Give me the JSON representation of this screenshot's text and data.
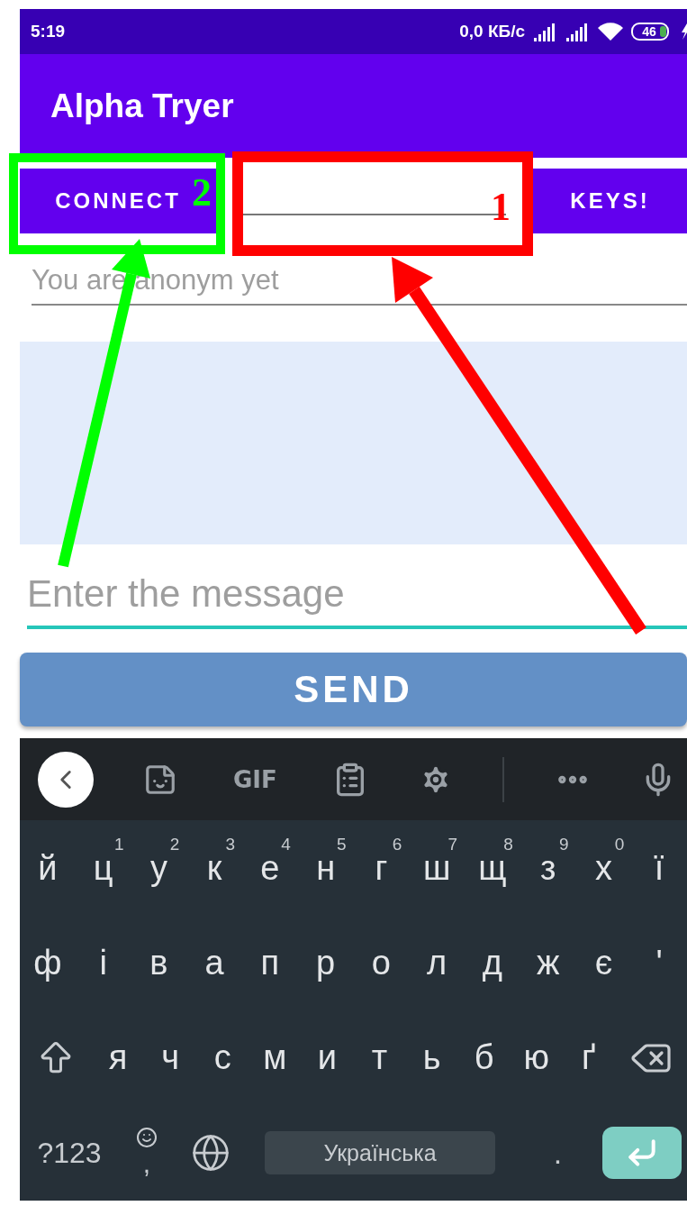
{
  "status_bar": {
    "time": "5:19",
    "network_speed": "0,0 КБ/с",
    "battery": "46"
  },
  "app_bar": {
    "title": "Alpha Tryer"
  },
  "action_row": {
    "connect_button": "CONNECT",
    "keys_button": "KEYS!"
  },
  "nickname_field": {
    "placeholder": "You are anonym yet"
  },
  "message_field": {
    "placeholder": "Enter the message"
  },
  "send_button": "SEND",
  "keyboard": {
    "toolbar": {
      "gif_button": "GIF"
    },
    "rows": [
      [
        {
          "key": "й"
        },
        {
          "key": "ц",
          "hint": "1"
        },
        {
          "key": "у",
          "hint": "2"
        },
        {
          "key": "к",
          "hint": "3"
        },
        {
          "key": "е",
          "hint": "4"
        },
        {
          "key": "н",
          "hint": "5"
        },
        {
          "key": "г",
          "hint": "6"
        },
        {
          "key": "ш",
          "hint": "7"
        },
        {
          "key": "щ",
          "hint": "8"
        },
        {
          "key": "з",
          "hint": "9"
        },
        {
          "key": "х",
          "hint": "0"
        },
        {
          "key": "ї"
        }
      ],
      [
        {
          "key": "ф"
        },
        {
          "key": "і"
        },
        {
          "key": "в"
        },
        {
          "key": "а"
        },
        {
          "key": "п"
        },
        {
          "key": "р"
        },
        {
          "key": "о"
        },
        {
          "key": "л"
        },
        {
          "key": "д"
        },
        {
          "key": "ж"
        },
        {
          "key": "є"
        },
        {
          "key": "'"
        }
      ],
      [
        {
          "kind": "shift"
        },
        {
          "key": "я"
        },
        {
          "key": "ч"
        },
        {
          "key": "с"
        },
        {
          "key": "м"
        },
        {
          "key": "и"
        },
        {
          "key": "т"
        },
        {
          "key": "ь"
        },
        {
          "key": "б"
        },
        {
          "key": "ю"
        },
        {
          "key": "ґ"
        },
        {
          "kind": "backspace"
        }
      ]
    ],
    "bottom_row": {
      "symbols_key": "?123",
      "comma_key": ",",
      "space_key": "Українська",
      "period_key": "."
    }
  },
  "annotations": [
    {
      "number": "2",
      "color": "#00ff00"
    },
    {
      "number": "1",
      "color": "#ff0000"
    }
  ]
}
